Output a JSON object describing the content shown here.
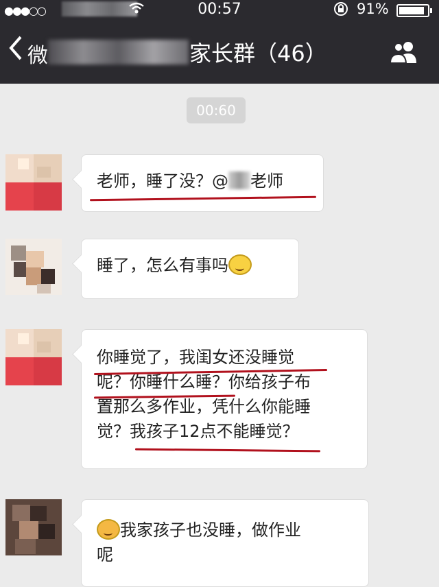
{
  "status_bar": {
    "signal": "●●●○○",
    "wifi": "✓",
    "time": "00:57",
    "lock": "⊕",
    "battery": "91%"
  },
  "nav": {
    "back_text": "微",
    "group_title": "家长群（46）"
  },
  "chat": {
    "timestamp": "00:60",
    "messages": [
      {
        "text_before": "老师，睡了没？@",
        "text_after": "老师"
      },
      {
        "text": "睡了，怎么有事吗"
      },
      {
        "lines": [
          "你睡觉了，我闺女还没睡觉",
          "呢？你睡什么睡？你给孩子布",
          "置那么多作业，凭什么你能睡",
          "觉？我孩子12点不能睡觉？"
        ]
      },
      {
        "lines": [
          "我家孩子也没睡，做作业",
          "呢"
        ]
      }
    ]
  },
  "colors": {
    "nav_bg": "#2b2a2f",
    "chat_bg": "#ebebeb",
    "underline": "#b1111d"
  }
}
